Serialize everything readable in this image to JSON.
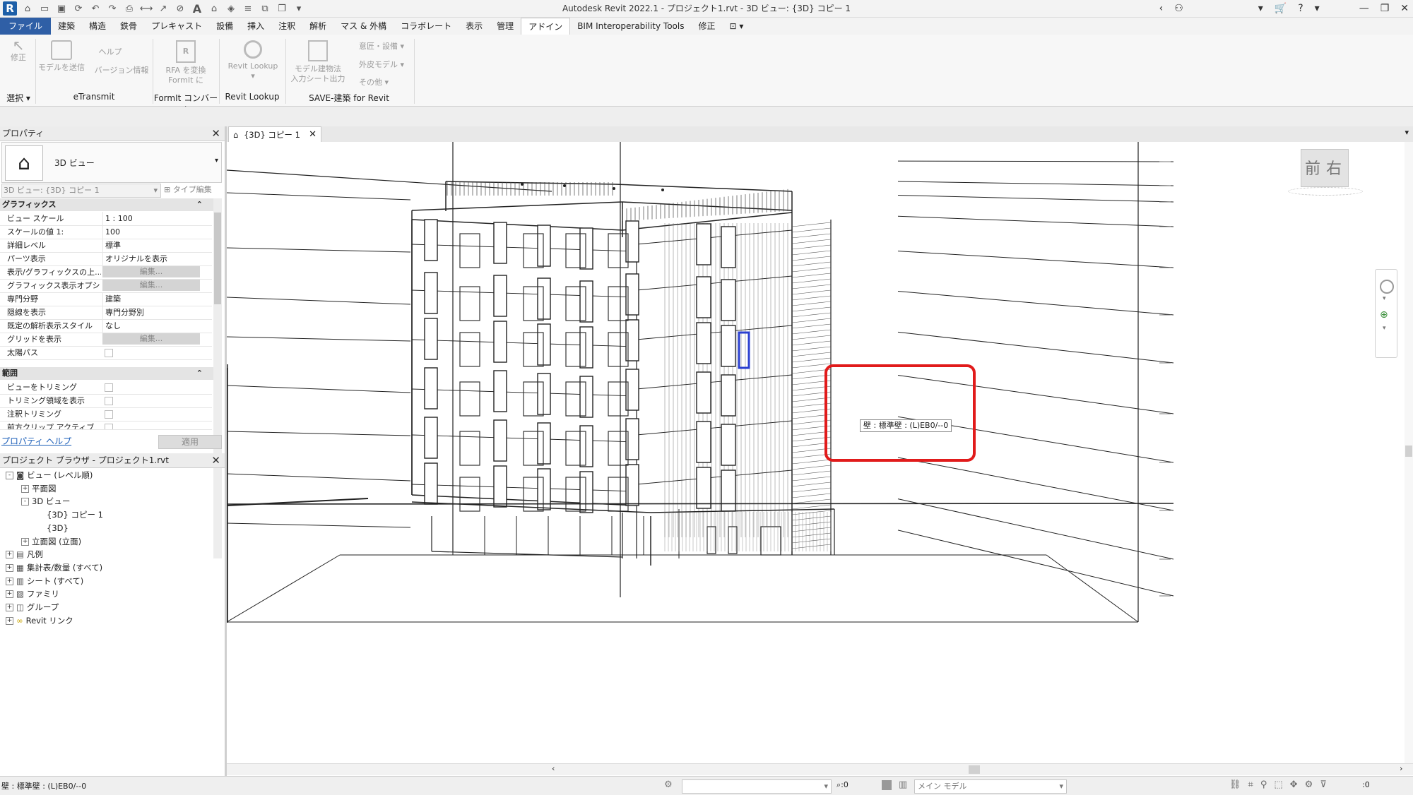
{
  "window": {
    "title": "Autodesk Revit 2022.1 - プロジェクト1.rvt - 3D ビュー: {3D} コピー 1",
    "app_logo": "R",
    "accent_color": "#2f5fa6",
    "highlight_color": "#e11b1b"
  },
  "quick_access": [
    "home-icon",
    "open-icon",
    "save-icon",
    "sync-icon",
    "undo-icon",
    "redo-icon",
    "print-icon",
    "measure-icon",
    "dimension-icon",
    "tag-icon",
    "text-icon",
    "3d-view-icon",
    "section-icon",
    "thin-lines-icon",
    "close-hidden-icon",
    "switch-windows-icon"
  ],
  "ribbon_tabs": [
    "ファイル",
    "建築",
    "構造",
    "鉄骨",
    "プレキャスト",
    "設備",
    "挿入",
    "注釈",
    "解析",
    "マス & 外構",
    "コラボレート",
    "表示",
    "管理",
    "アドイン",
    "BIM Interoperability Tools",
    "修正"
  ],
  "active_tab": "アドイン",
  "ribbon": {
    "modify_label": "修正",
    "send_model_label": "モデルを送信",
    "help_label": "ヘルプ",
    "version_label": "バージョン情報",
    "rfa_convert_label1": "RFA を変換",
    "rfa_convert_label2": "FormIt に",
    "revit_lookup_label": "Revit Lookup",
    "model_label1": "モデル建物法",
    "model_label2": "入力シート出力",
    "design_label": "意匠・設備",
    "exterior_label": "外皮モデル",
    "other_label": "その他",
    "panel_select": "選択",
    "panel_etransmit": "eTransmit",
    "panel_formit": "FormIt コンバータ",
    "panel_lookup": "Revit Lookup",
    "panel_save": "SAVE-建築 for Revit"
  },
  "properties": {
    "title": "プロパティ",
    "type_name": "3D ビュー",
    "selector_value": "3D ビュー: {3D} コピー 1",
    "edit_type_label": "タイプ編集",
    "section_graphics": "グラフィックス",
    "rows": [
      {
        "k": "ビュー スケール",
        "v": "1 : 100"
      },
      {
        "k": "スケールの値    1:",
        "v": "100"
      },
      {
        "k": "詳細レベル",
        "v": "標準"
      },
      {
        "k": "パーツ表示",
        "v": "オリジナルを表示"
      },
      {
        "k": "表示/グラフィックスの上...",
        "v": "編集..."
      },
      {
        "k": "グラフィックス表示オプション",
        "v": "編集..."
      },
      {
        "k": "専門分野",
        "v": "建築"
      },
      {
        "k": "隠線を表示",
        "v": "専門分野別"
      },
      {
        "k": "既定の解析表示スタイル",
        "v": "なし"
      },
      {
        "k": "グリッドを表示",
        "v": "編集..."
      },
      {
        "k": "太陽パス",
        "v": ""
      }
    ],
    "section_extents": "範囲",
    "rows2": [
      {
        "k": "ビューをトリミング",
        "v": ""
      },
      {
        "k": "トリミング領域を表示",
        "v": ""
      },
      {
        "k": "注釈トリミング",
        "v": ""
      },
      {
        "k": "前方クリップ アクティブ",
        "v": ""
      }
    ],
    "help_link": "プロパティ ヘルプ",
    "apply_label": "適用"
  },
  "browser": {
    "title": "プロジェクト ブラウザ - プロジェクト1.rvt",
    "items": [
      "ビュー (レベル順)",
      "平面図",
      "3D ビュー",
      "{3D} コピー 1",
      "{3D}",
      "立面図 (立面)",
      "凡例",
      "集計表/数量 (すべて)",
      "シート (すべて)",
      "ファミリ",
      "グループ",
      "Revit リンク"
    ]
  },
  "document_tab": "{3D} コピー 1",
  "viewcube": {
    "front": "前",
    "right": "右"
  },
  "tooltip": "壁 : 標準壁 : (L)EB0/--0",
  "status": {
    "message": "壁 : 標準壁 : (L)EB0/--0",
    "filter_count": ":0",
    "model_label": "メイン モデル",
    "select_count": ":0"
  }
}
